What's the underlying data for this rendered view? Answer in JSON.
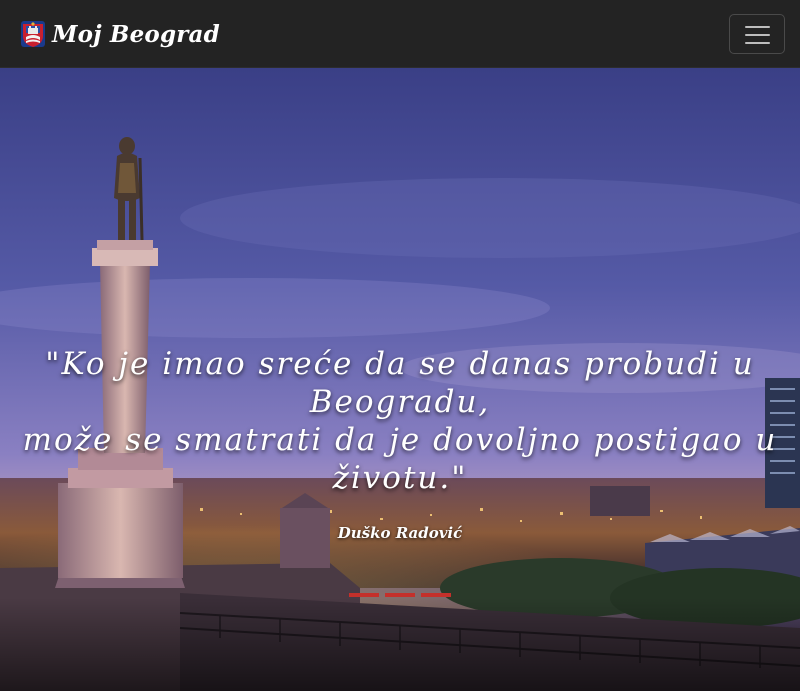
{
  "navbar": {
    "brand_text": "Moj Beograd",
    "brand_icon": "belgrade-coat-of-arms",
    "toggler_icon": "hamburger-menu-icon"
  },
  "hero": {
    "quote_line1": "\"Ko je imao sreće da se danas probudi u",
    "quote_line2": "Beogradu,",
    "quote_line3": "može se smatrati da je dovoljno postigao u",
    "quote_line4": "životu.\"",
    "author": "Duško Radović",
    "image": "pobednik-monument-night-panorama",
    "indicator_count": 3,
    "active_indicator": 1
  },
  "colors": {
    "navbar_bg": "#232323",
    "indicator": "#c4302b",
    "sky_top": "#3a3f86",
    "sky_horizon": "#8f7fc4"
  }
}
